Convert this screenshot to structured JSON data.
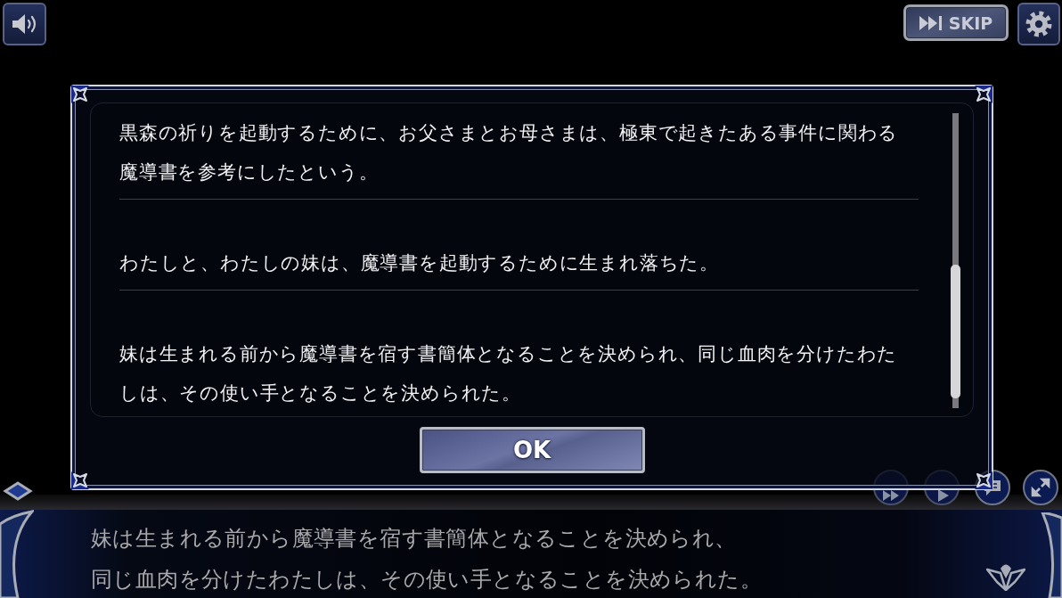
{
  "top_bar": {
    "skip_button": {
      "label": "SKIP"
    }
  },
  "log_dialog": {
    "entries": [
      {
        "lines": [
          "黒森の祈りを起動するために、お父さまとお母さまは、極東で起きたある事件に関わる",
          "魔導書を参考にしたという。"
        ]
      },
      {
        "lines": [
          "わたしと、わたしの妹は、魔導書を起動するために生まれ落ちた。"
        ]
      },
      {
        "lines": [
          "妹は生まれる前から魔導書を宿す書簡体となることを決められ、同じ血肉を分けたわた",
          "しは、その使い手となることを決められた。"
        ]
      }
    ],
    "ok_button": {
      "label": "OK"
    }
  },
  "message_box": {
    "lines": [
      "妹は生まれる前から魔導書を宿す書簡体となることを決められ、",
      "同じ血肉を分けたわたしは、その使い手となることを決められた。"
    ]
  }
}
